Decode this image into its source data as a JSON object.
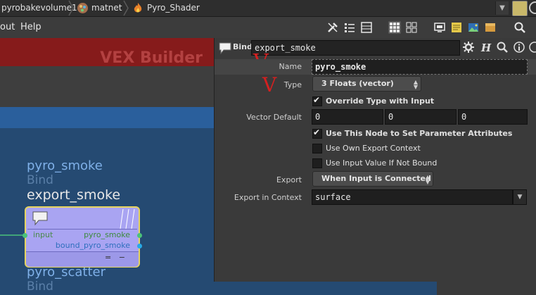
{
  "pathbar": {
    "crumbs": [
      "pyrobakevolume1",
      "matnet",
      "Pyro_Shader"
    ],
    "dropdown_arrow": "▼",
    "icons": [
      "matnet-icon",
      "fire-icon",
      "pin-icon",
      "network-ring-icon"
    ]
  },
  "menubar": {
    "items": [
      "out",
      "Help"
    ],
    "toolbar_icons": [
      "tools-icon",
      "list-icon",
      "table-icon",
      "grid-view-icon",
      "tree-view-icon",
      "display-icon",
      "note-icon",
      "image-icon",
      "box-icon",
      "search-icon"
    ]
  },
  "network": {
    "context_title": "VEX Builder",
    "nodes": [
      {
        "name": "pyro_smoke",
        "type": "Bind"
      },
      {
        "name": "export_smoke"
      },
      {
        "name": "pyro_scatter",
        "type": "Bind"
      }
    ],
    "node": {
      "input_port": "input",
      "output_ports": [
        "pyro_smoke",
        "bound_pyro_smoke"
      ],
      "bottom_marks": "=   −",
      "colors": {
        "body": "#a9a4f2",
        "border": "#e7d45f",
        "input_dot": "#4ac27a",
        "output_dot_1": "#4ac27a",
        "output_dot_2": "#27a9e6"
      }
    }
  },
  "panel": {
    "op_type": "Bind",
    "op_name": "export_smoke",
    "header_icons": [
      "gear-icon",
      "help-h-icon",
      "search-icon",
      "info-icon",
      "question-icon"
    ],
    "annotations": [
      "V",
      "V"
    ],
    "params": {
      "name_label": "Name",
      "name_value": "pyro_smoke",
      "type_label": "Type",
      "type_value": "3 Floats (vector)",
      "override_label": "Override Type with Input",
      "override_checked": true,
      "vector_default_label": "Vector Default",
      "vector_default": [
        "0",
        "0",
        "0"
      ],
      "use_node_label": "Use This Node to Set Parameter Attributes",
      "use_node_checked": true,
      "own_export_label": "Use Own Export Context",
      "own_export_checked": false,
      "input_value_label": "Use Input Value If Not Bound",
      "input_value_checked": false,
      "export_label": "Export",
      "export_value": "When Input is Connected",
      "export_context_label": "Export in Context",
      "export_context_value": "surface"
    }
  }
}
